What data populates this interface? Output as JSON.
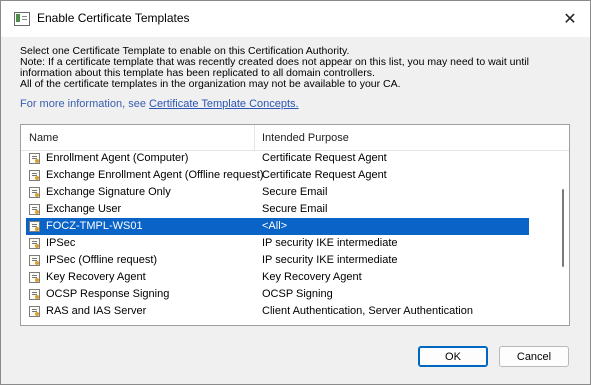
{
  "window": {
    "title": "Enable Certificate Templates",
    "close_glyph": "✕",
    "icon": "dialog-app-icon"
  },
  "description": {
    "line1": "Select one Certificate Template to enable on this Certification Authority.",
    "line2": "Note: If a certificate template that was recently created does not appear on this list, you may need to wait until",
    "line3": "information about this template has been replicated to all domain controllers.",
    "line4": "All of the certificate templates in the organization may not be available to your CA.",
    "info_prefix": "For more information, see ",
    "info_link": "Certificate Template Concepts."
  },
  "list": {
    "columns": [
      "Name",
      "Intended Purpose"
    ],
    "rows": [
      {
        "name": "Enrollment Agent (Computer)",
        "purpose": "Certificate Request Agent"
      },
      {
        "name": "Exchange Enrollment Agent (Offline request)",
        "purpose": "Certificate Request Agent"
      },
      {
        "name": "Exchange Signature Only",
        "purpose": "Secure Email"
      },
      {
        "name": "Exchange User",
        "purpose": "Secure Email"
      },
      {
        "name": "FOCZ-TMPL-WS01",
        "purpose": "<All>",
        "selected": true
      },
      {
        "name": "IPSec",
        "purpose": "IP security IKE intermediate"
      },
      {
        "name": "IPSec (Offline request)",
        "purpose": "IP security IKE intermediate"
      },
      {
        "name": "Key Recovery Agent",
        "purpose": "Key Recovery Agent"
      },
      {
        "name": "OCSP Response Signing",
        "purpose": "OCSP Signing"
      },
      {
        "name": "RAS and IAS Server",
        "purpose": "Client Authentication, Server Authentication"
      }
    ],
    "row_icon": "certificate-template-icon",
    "selection_color": "#0a64c8"
  },
  "buttons": {
    "ok": "OK",
    "cancel": "Cancel"
  }
}
